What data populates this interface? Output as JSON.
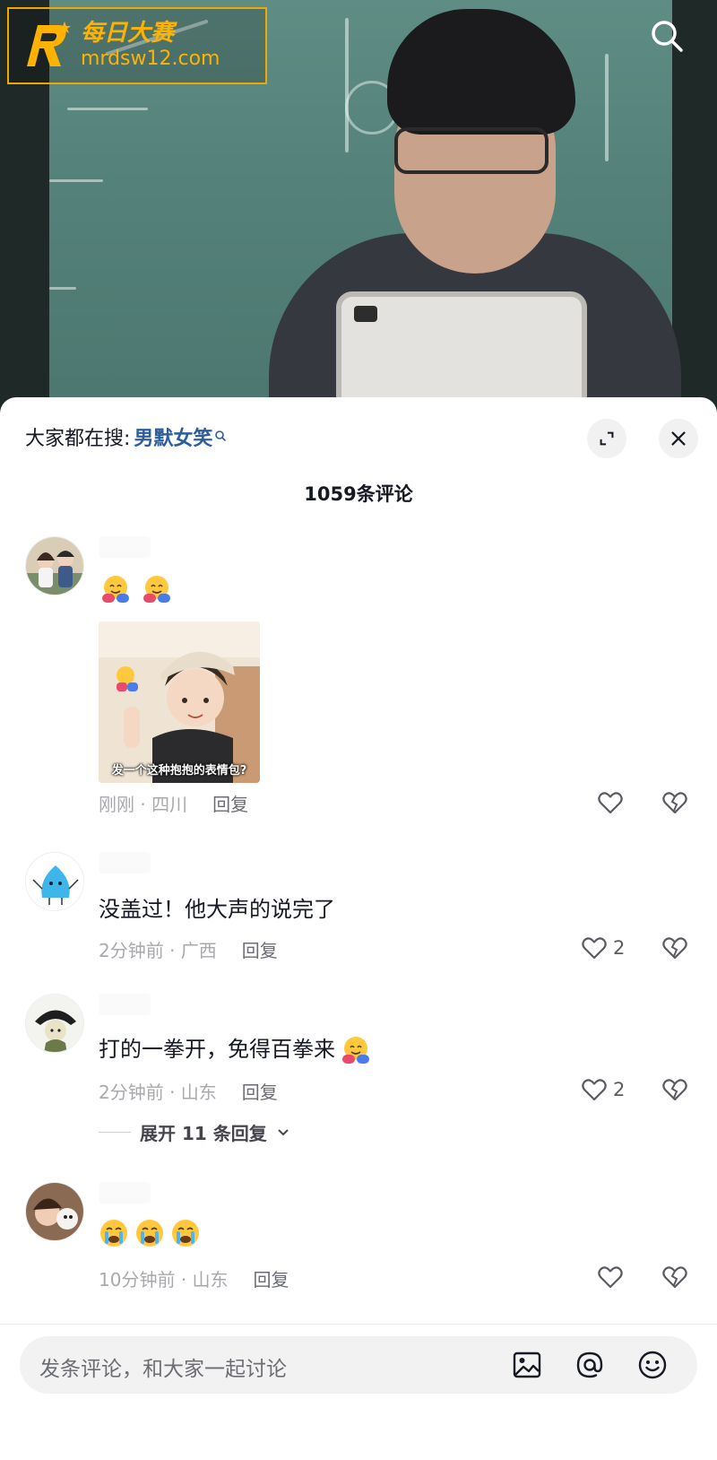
{
  "watermark": {
    "brand": "每日大赛",
    "url": "mrdsw12.com"
  },
  "video": {
    "search_icon": "search-icon"
  },
  "sheet": {
    "suggest_prefix": "大家都在搜:",
    "suggest_keyword": "男默女笑",
    "comment_count_title": "1059条评论"
  },
  "comments": [
    {
      "text": "",
      "sticker_caption": "发一个这种抱抱的表情包?",
      "time_location": "刚刚 · 四川",
      "reply_label": "回复",
      "likes": ""
    },
    {
      "text": "没盖过！他大声的说完了",
      "time_location": "2分钟前 · 广西",
      "reply_label": "回复",
      "likes": "2"
    },
    {
      "text": "打的一拳开，免得百拳来",
      "time_location": "2分钟前 · 山东",
      "reply_label": "回复",
      "likes": "2",
      "expand_replies": "展开 11 条回复"
    },
    {
      "text": "",
      "time_location": "10分钟前 · 山东",
      "reply_label": "回复",
      "likes": ""
    }
  ],
  "input": {
    "placeholder": "发条评论，和大家一起讨论"
  },
  "colors": {
    "keyword": "#2c5d9e",
    "meta": "#a8a9ad",
    "watermark": "#ffb300"
  }
}
